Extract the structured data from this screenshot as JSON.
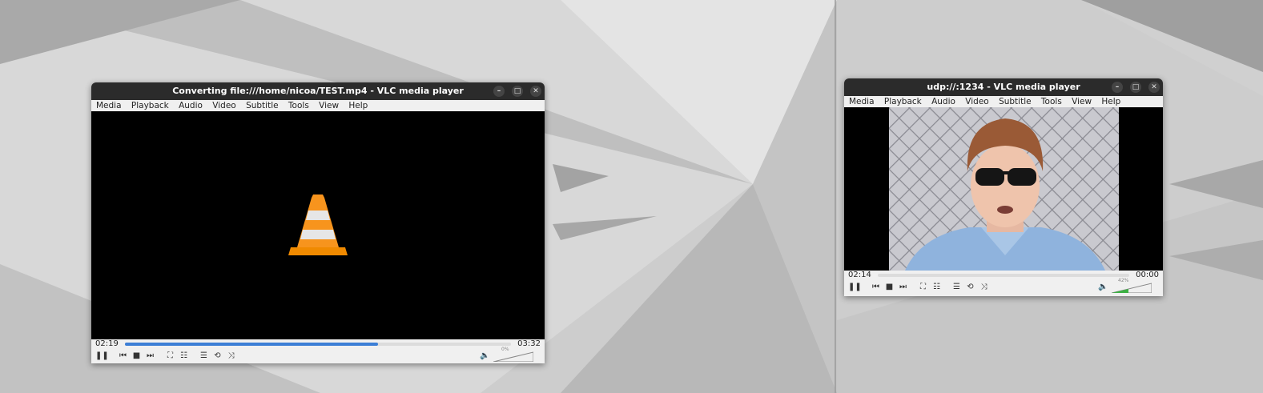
{
  "windows": [
    {
      "title": "Converting file:///home/nicoa/TEST.mp4 - VLC media player",
      "menu": [
        "Media",
        "Playback",
        "Audio",
        "Video",
        "Subtitle",
        "Tools",
        "View",
        "Help"
      ],
      "time_elapsed": "02:19",
      "time_total": "03:32",
      "seek_progress": 0.655,
      "volume_label": "0%",
      "volume_level": 0,
      "video_content": "vlc-cone-icon"
    },
    {
      "title": "udp://:1234 - VLC media player",
      "menu": [
        "Media",
        "Playback",
        "Audio",
        "Video",
        "Subtitle",
        "Tools",
        "View",
        "Help"
      ],
      "time_elapsed": "02:14",
      "time_total": "00:00",
      "seek_progress": 0,
      "volume_label": "42%",
      "volume_level": 0.42,
      "video_content": "video-frame-person"
    }
  ],
  "icons": {
    "pause": "pause-icon",
    "prev": "previous-icon",
    "stop": "stop-icon",
    "next": "next-icon",
    "fullscreen": "fullscreen-icon",
    "extended": "extended-settings-icon",
    "playlist": "playlist-icon",
    "loop": "loop-icon",
    "shuffle": "shuffle-icon",
    "volume": "volume-icon"
  },
  "colors": {
    "seek_fill": "#3c7ed6",
    "volume_fill": "#3cb043",
    "titlebar": "#2b2b2b"
  }
}
